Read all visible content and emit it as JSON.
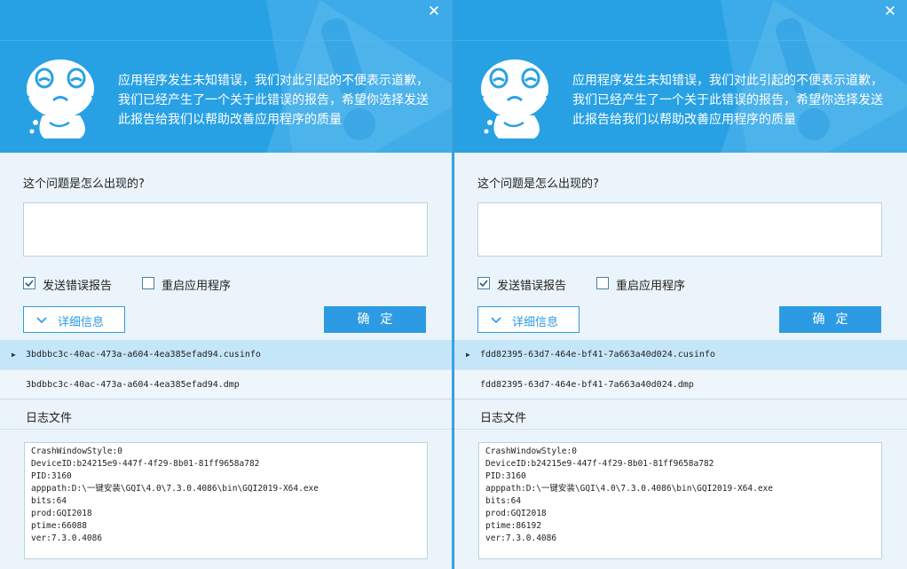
{
  "colors": {
    "header_blue": "#28a1e4",
    "accent_blue": "#2d9be3",
    "selected_row": "#c5e6f8"
  },
  "dialogs": [
    {
      "message": "应用程序发生未知错误，我们对此引起的不便表示道歉，我们已经产生了一个关于此错误的报告，希望你选择发送此报告给我们以帮助改善应用程序的质量",
      "close_icon": "close-icon",
      "question": "这个问题是怎么出现的?",
      "description_value": "",
      "send_report_label": "发送错误报告",
      "send_report_checked": true,
      "restart_label": "重启应用程序",
      "restart_checked": false,
      "details_label": "详细信息",
      "ok_label": "确定",
      "files": [
        "3bdbbc3c-40ac-473a-a604-4ea385efad94.cusinfo",
        "3bdbbc3c-40ac-473a-a604-4ea385efad94.dmp"
      ],
      "log_title": "日志文件",
      "log_lines": [
        "CrashWindowStyle:0",
        "DeviceID:b24215e9-447f-4f29-8b01-81ff9658a782",
        "PID:3160",
        "apppath:D:\\一键安装\\GQI\\4.0\\7.3.0.4086\\bin\\GQI2019-X64.exe",
        "bits:64",
        "prod:GQI2018",
        "ptime:66088",
        "ver:7.3.0.4086"
      ]
    },
    {
      "message": "应用程序发生未知错误，我们对此引起的不便表示道歉，我们已经产生了一个关于此错误的报告，希望你选择发送此报告给我们以帮助改善应用程序的质量",
      "close_icon": "close-icon",
      "question": "这个问题是怎么出现的?",
      "description_value": "",
      "send_report_label": "发送错误报告",
      "send_report_checked": true,
      "restart_label": "重启应用程序",
      "restart_checked": false,
      "details_label": "详细信息",
      "ok_label": "确定",
      "files": [
        "fdd82395-63d7-464e-bf41-7a663a40d024.cusinfo",
        "fdd82395-63d7-464e-bf41-7a663a40d024.dmp"
      ],
      "log_title": "日志文件",
      "log_lines": [
        "CrashWindowStyle:0",
        "DeviceID:b24215e9-447f-4f29-8b01-81ff9658a782",
        "PID:3160",
        "apppath:D:\\一键安装\\GQI\\4.0\\7.3.0.4086\\bin\\GQI2019-X64.exe",
        "bits:64",
        "prod:GQI2018",
        "ptime:86192",
        "ver:7.3.0.4086"
      ]
    }
  ]
}
